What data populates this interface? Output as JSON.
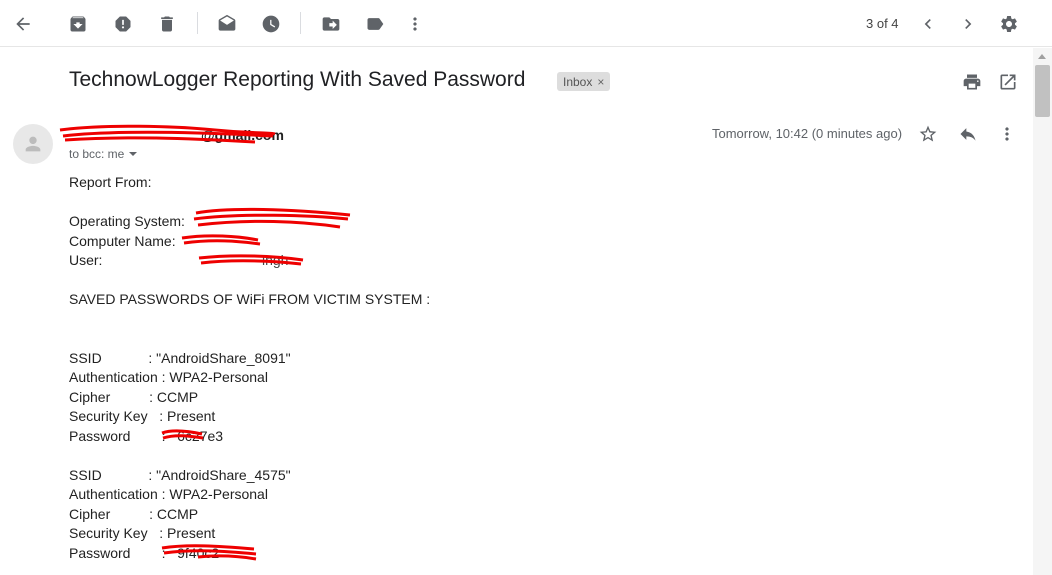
{
  "toolbar": {
    "pager": "3 of 4"
  },
  "message": {
    "subject": "TechnowLogger Reporting With Saved Password",
    "label": "Inbox",
    "label_remove": "×",
    "sender": "@gmail.com",
    "recipient": "to bcc: me",
    "date": "Tomorrow, 10:42 (0 minutes ago)"
  },
  "body": {
    "report_from": "Report From:",
    "os_label": "Operating System:",
    "computer_label": "Computer Name:",
    "user_label": "User:",
    "user_value": "ingh",
    "saved_header": "SAVED PASSWORDS OF WiFi FROM VICTIM SYSTEM :",
    "networks": [
      {
        "ssid": "SSID            : \"AndroidShare_8091\"",
        "auth": "Authentication : WPA2-Personal",
        "cipher": "Cipher          : CCMP",
        "key": "Security Key   : Present",
        "password": "Password        :   6c27e3"
      },
      {
        "ssid": "SSID            : \"AndroidShare_4575\"",
        "auth": "Authentication : WPA2-Personal",
        "cipher": "Cipher          : CCMP",
        "key": "Security Key   : Present",
        "password": "Password        :   9f40c2"
      }
    ]
  }
}
